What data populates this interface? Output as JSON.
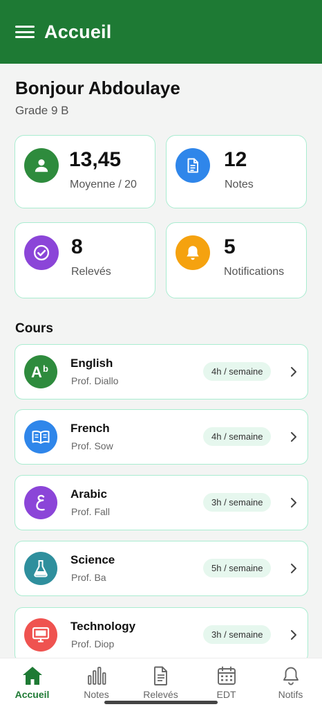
{
  "appbar": {
    "title": "Accueil",
    "menu_icon": "menu-icon"
  },
  "greeting": {
    "title": "Bonjour Abdoulaye",
    "grade": "Grade 9 B"
  },
  "stats": [
    {
      "value": "13,45",
      "label": "Moyenne / 20",
      "icon": "user-icon",
      "color": "#2e8b3d"
    },
    {
      "value": "12",
      "label": "Notes",
      "icon": "document-icon",
      "color": "#2f86ea"
    },
    {
      "value": "8",
      "label": "Relevés",
      "icon": "check-badge-icon",
      "color": "#8b45d8"
    },
    {
      "value": "5",
      "label": "Notifications",
      "icon": "bell-icon",
      "color": "#f5a20f"
    }
  ],
  "courses_title": "Cours",
  "courses": [
    {
      "name": "English",
      "prof": "Prof. Diallo",
      "hours": "4h / semaine",
      "icon": "language-ab-icon",
      "color": "#2e8b3d"
    },
    {
      "name": "French",
      "prof": "Prof. Sow",
      "hours": "4h / semaine",
      "icon": "book-open-icon",
      "color": "#2f86ea"
    },
    {
      "name": "Arabic",
      "prof": "Prof. Fall",
      "hours": "3h / semaine",
      "icon": "arabic-letter-icon",
      "color": "#8b45d8"
    },
    {
      "name": "Science",
      "prof": "Prof. Ba",
      "hours": "5h / semaine",
      "icon": "flask-icon",
      "color": "#2f8f9d"
    },
    {
      "name": "Technology",
      "prof": "Prof. Diop",
      "hours": "3h / semaine",
      "icon": "monitor-icon",
      "color": "#ef5350"
    }
  ],
  "nav": [
    {
      "label": "Accueil",
      "icon": "home-icon",
      "active": true
    },
    {
      "label": "Notes",
      "icon": "bar-chart-icon",
      "active": false
    },
    {
      "label": "Relevés",
      "icon": "document-icon",
      "active": false
    },
    {
      "label": "EDT",
      "icon": "calendar-icon",
      "active": false
    },
    {
      "label": "Notifs",
      "icon": "bell-icon",
      "active": false
    }
  ],
  "colors": {
    "primary": "#1e7a34",
    "card_border": "#a9ecd0",
    "badge_bg": "#e6f7ee"
  }
}
